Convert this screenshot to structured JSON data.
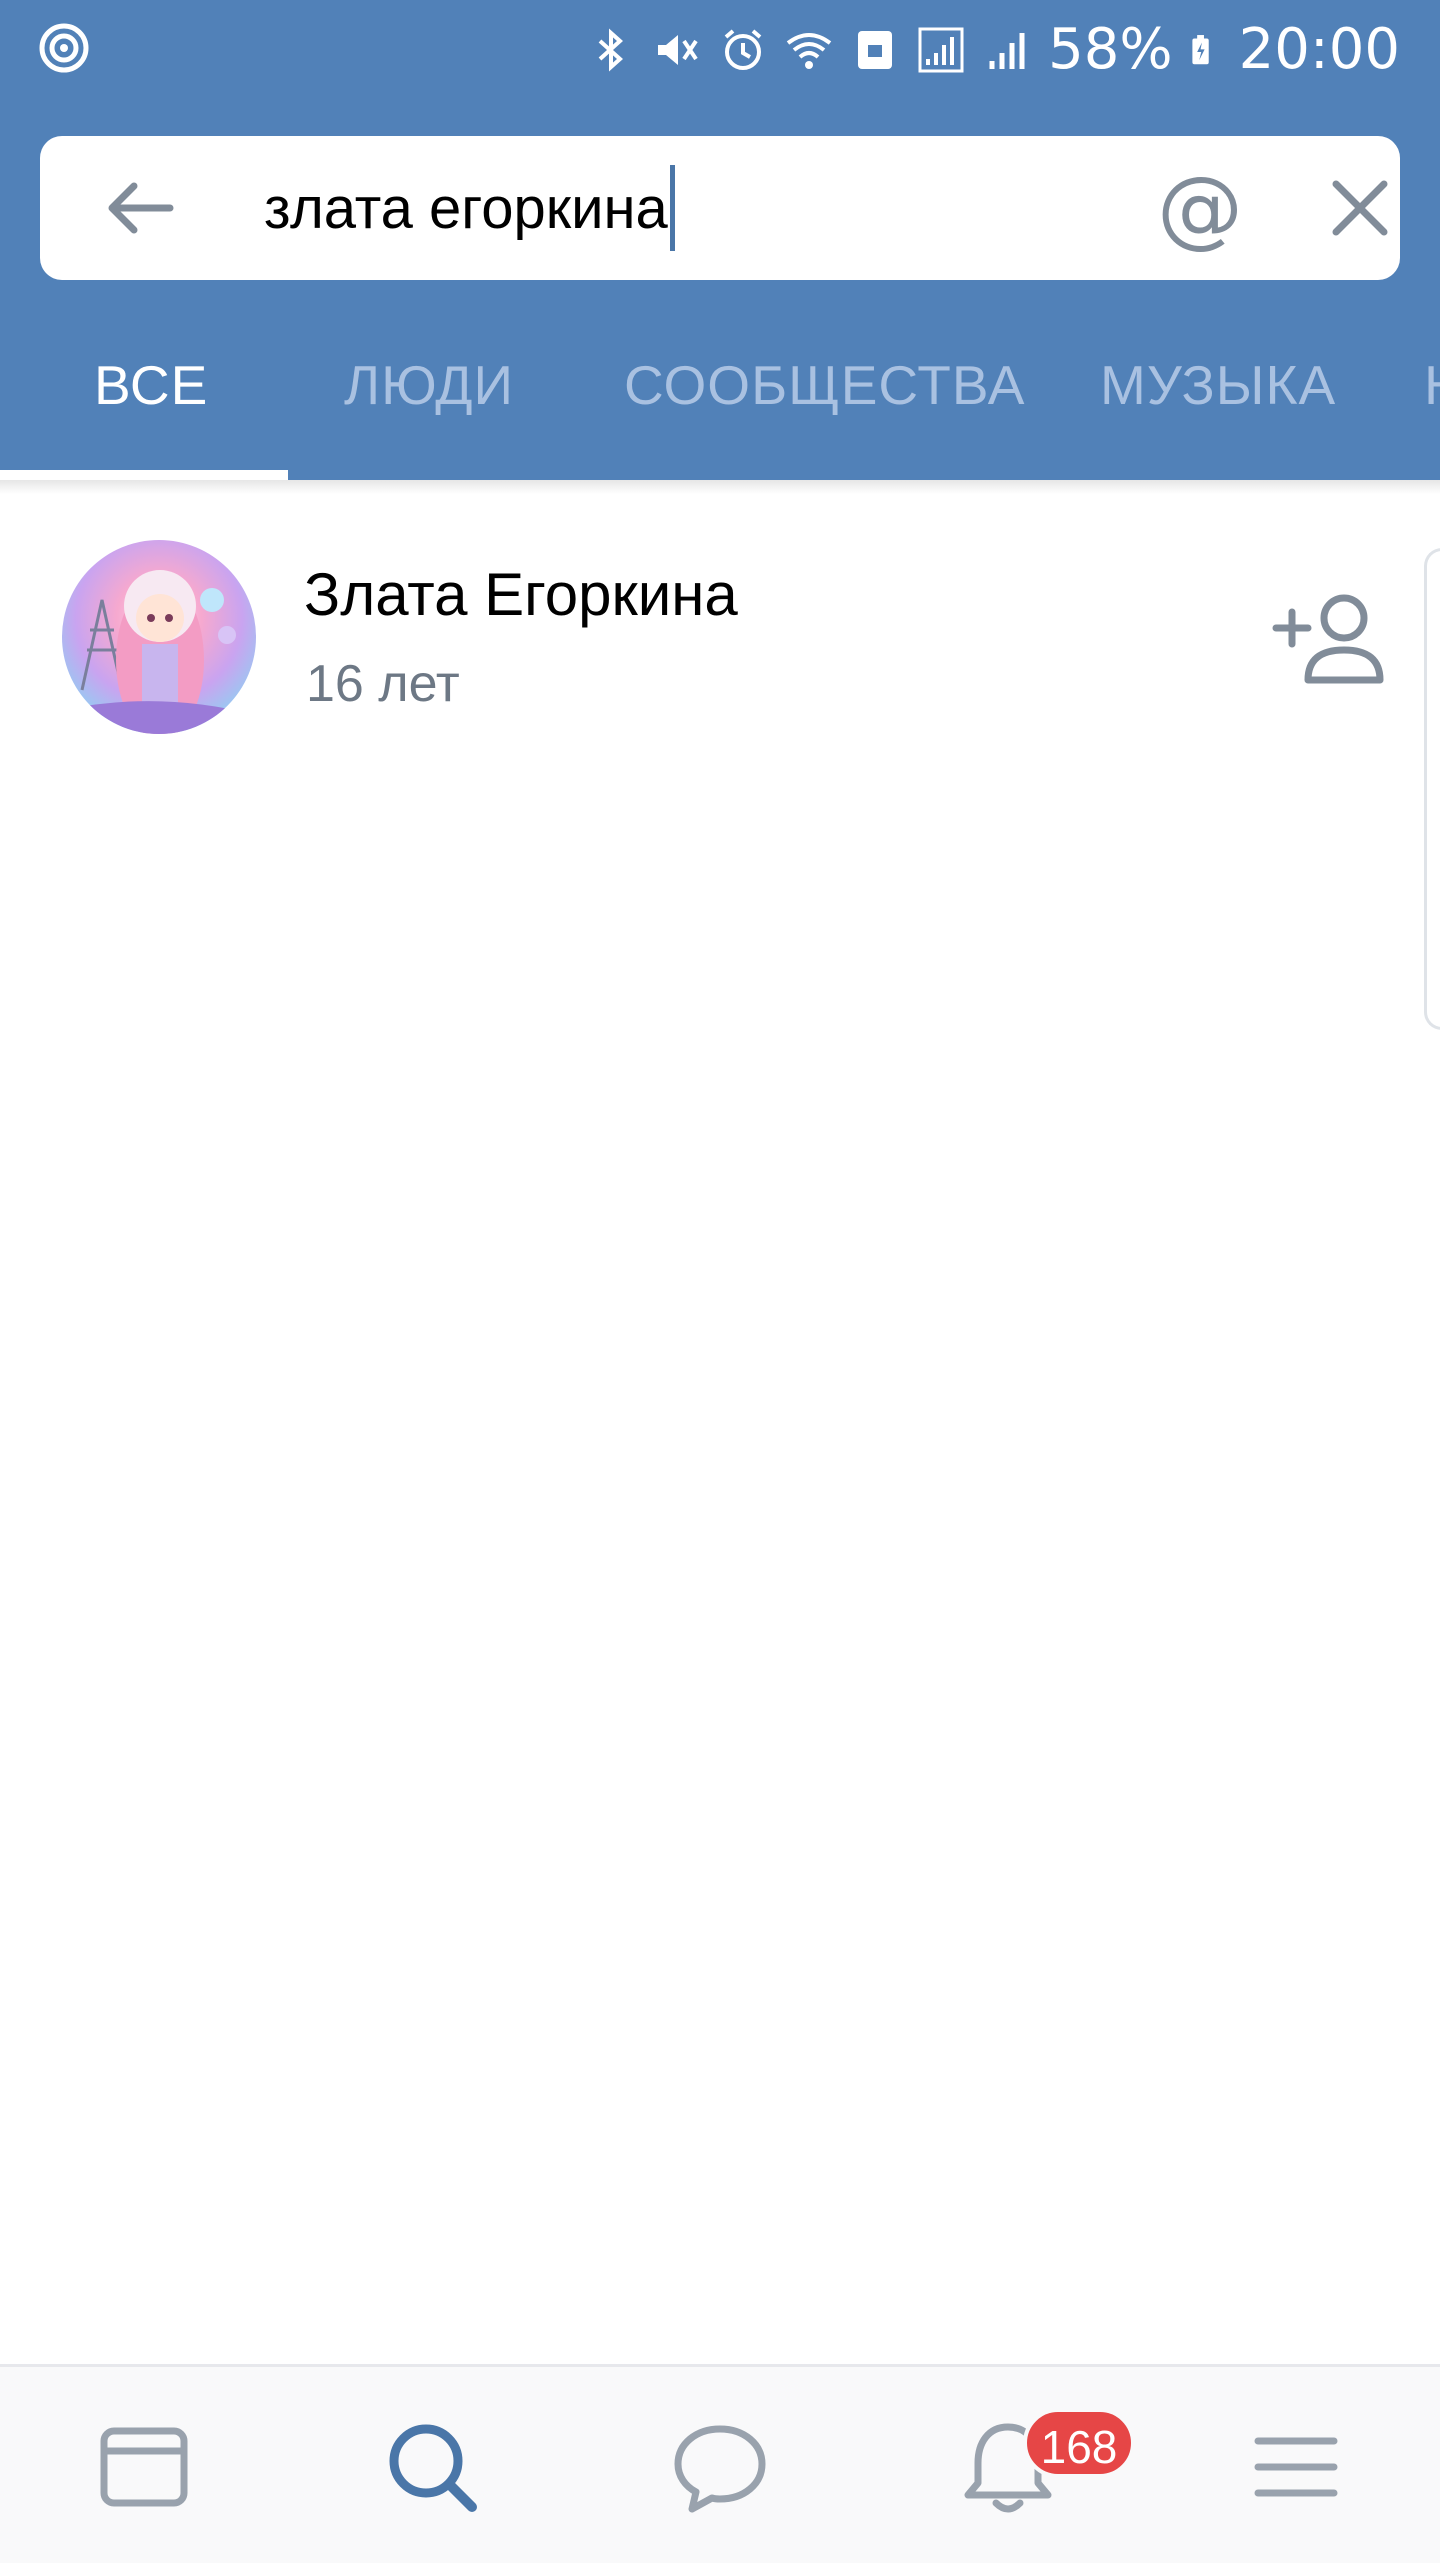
{
  "status_bar": {
    "battery": "58%",
    "time": "20:00",
    "icons": [
      "notification-icon",
      "bluetooth-icon",
      "vibrate-icon",
      "alarm-icon",
      "wifi-icon",
      "nfc-icon",
      "signal-icon",
      "signal-icon",
      "battery-charging-icon"
    ]
  },
  "search": {
    "query": "злата егоркина",
    "back_icon": "arrow-left-icon",
    "mention_symbol": "@",
    "clear_icon": "close-icon"
  },
  "tabs": [
    {
      "label": "ВСЕ",
      "active": true
    },
    {
      "label": "ЛЮДИ",
      "active": false
    },
    {
      "label": "СООБЩЕСТВА",
      "active": false
    },
    {
      "label": "МУЗЫКА",
      "active": false
    },
    {
      "label": "Н",
      "active": false
    }
  ],
  "results": [
    {
      "name": "Злата Егоркина",
      "subtitle": "16 лет",
      "action_icon": "add-friend-icon"
    }
  ],
  "bottom_nav": {
    "items": [
      "news-icon",
      "search-icon",
      "messages-icon",
      "notifications-icon",
      "menu-icon"
    ],
    "active": "search-icon",
    "notifications_badge": "168"
  },
  "colors": {
    "header": "#5181b8",
    "tab_inactive": "#a9c1e1",
    "accent": "#4a76a8",
    "badge": "#e64646",
    "icon_gray": "#818c99"
  }
}
